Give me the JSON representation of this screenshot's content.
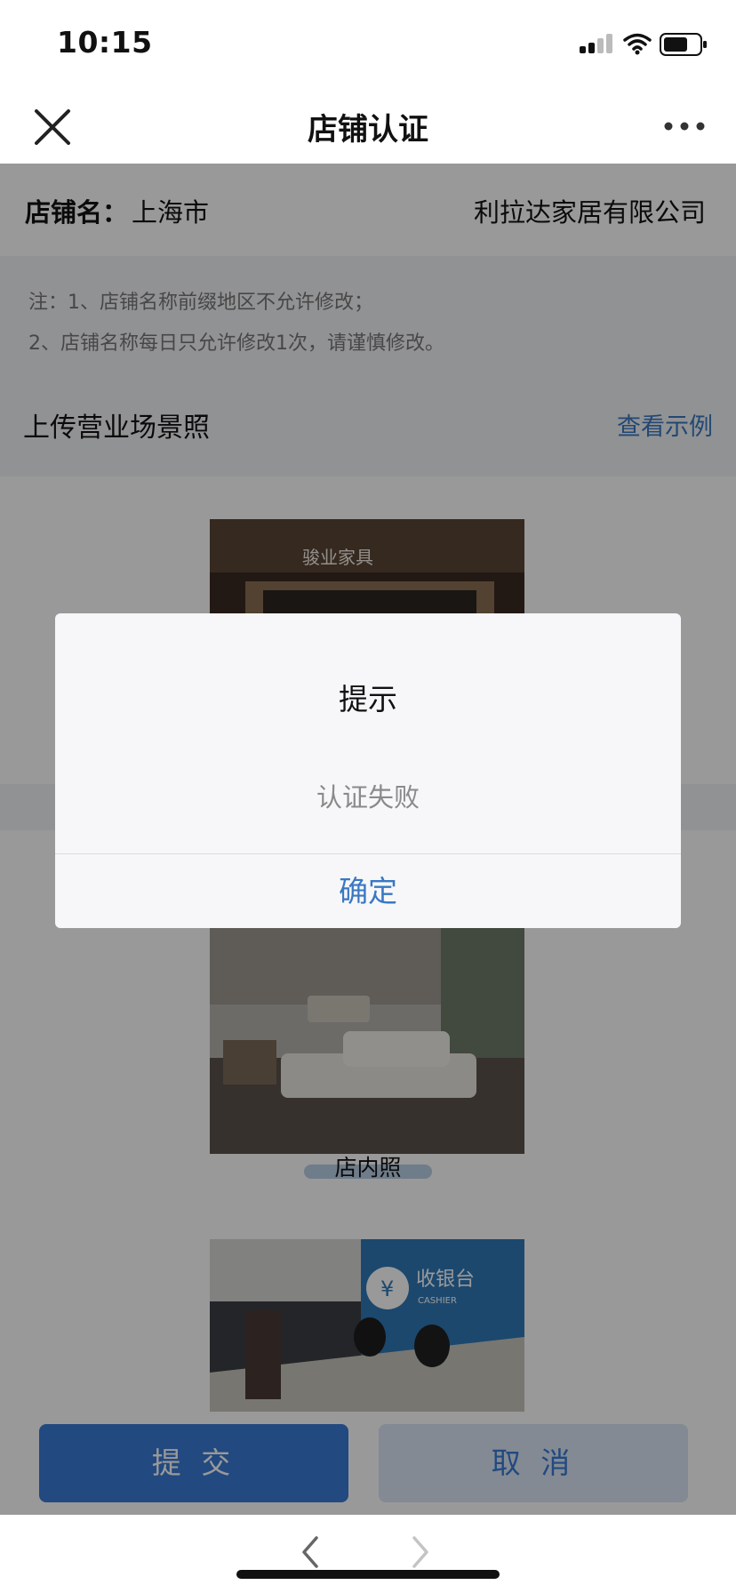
{
  "status_bar": {
    "time": "10:15"
  },
  "nav": {
    "title": "店铺认证"
  },
  "shop": {
    "label": "店铺名：",
    "prefix": "上海市",
    "name": "利拉达家居有限公司"
  },
  "notes": [
    "注：1、店铺名称前缀地区不允许修改；",
    "2、店铺名称每日只允许修改1次，请谨慎修改。"
  ],
  "upload": {
    "title": "上传营业场景照",
    "example_link": "查看示例"
  },
  "photos": [
    {
      "sign_text": "骏业家具",
      "caption": ""
    },
    {
      "caption": "店内照"
    },
    {
      "sign_title": "收银台",
      "sign_sub": "CASHIER"
    }
  ],
  "buttons": {
    "submit": "提 交",
    "cancel": "取 消"
  },
  "dialog": {
    "title": "提示",
    "message": "认证失败",
    "ok": "确定"
  },
  "colors": {
    "accent": "#3a7bd5",
    "link": "#3a78c3",
    "overlay": "rgba(0,0,0,0.40)"
  }
}
